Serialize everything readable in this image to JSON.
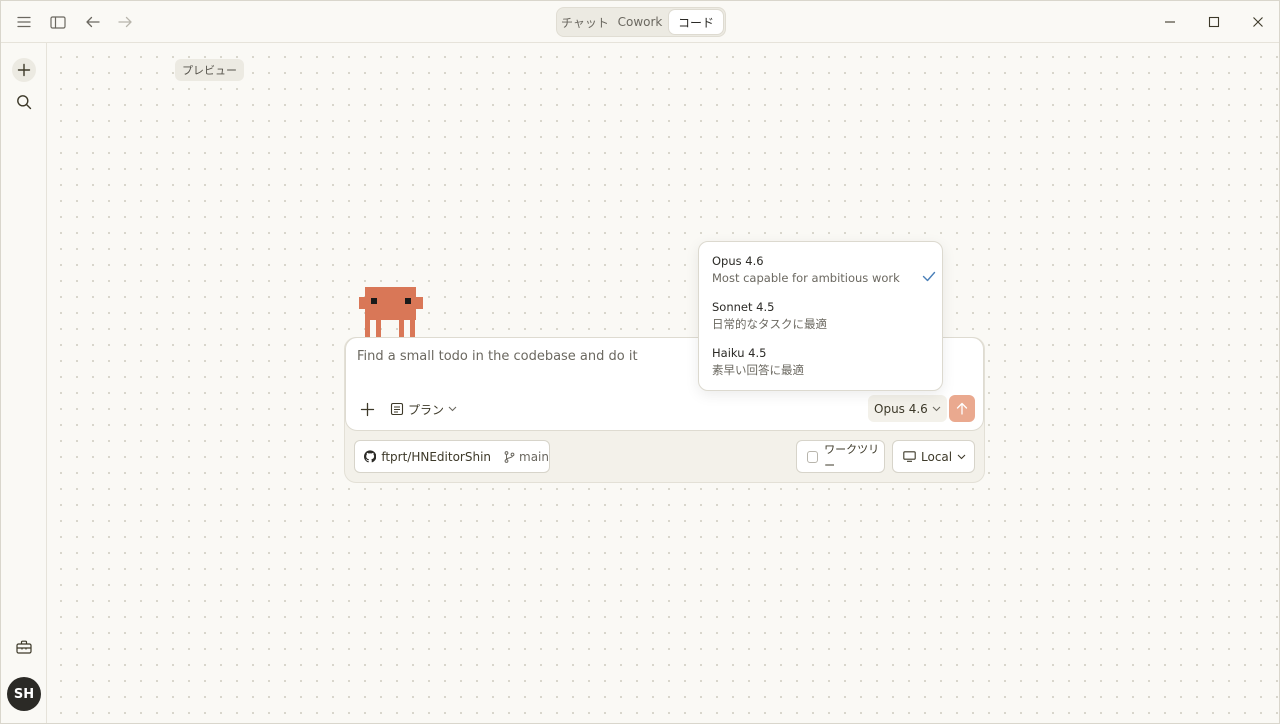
{
  "titlebar": {
    "modes": [
      {
        "label": "チャット",
        "active": false
      },
      {
        "label": "Cowork",
        "active": false
      },
      {
        "label": "コード",
        "active": true
      }
    ]
  },
  "main": {
    "preview_chip": "プレビュー"
  },
  "composer": {
    "prompt_placeholder": "Find a small todo in the codebase and do it",
    "plan_label": "プラン",
    "model_label": "Opus 4.6"
  },
  "footer": {
    "repo": "ftprt/HNEditorShin",
    "branch": "main",
    "worktree_label": "ワークツリー",
    "environment_label": "Local"
  },
  "model_menu": {
    "options": [
      {
        "name": "Opus 4.6",
        "description": "Most capable for ambitious work",
        "selected": true
      },
      {
        "name": "Sonnet 4.5",
        "description": "日常的なタスクに最適",
        "selected": false
      },
      {
        "name": "Haiku 4.5",
        "description": "素早い回答に最適",
        "selected": false
      }
    ]
  },
  "user": {
    "initials": "SH"
  },
  "colors": {
    "accent": "#d97757",
    "send_disabled": "#eaa98f",
    "check": "#4a7fb8"
  }
}
